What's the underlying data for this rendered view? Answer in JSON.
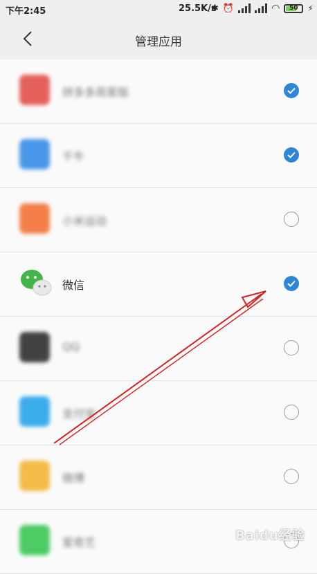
{
  "statusbar": {
    "time": "下午2:45",
    "speed": "25.5K/s",
    "battery": "50"
  },
  "header": {
    "title": "管理应用"
  },
  "apps": [
    {
      "name": "拼多多商家版",
      "checked": true,
      "icon_color": "#e0473f",
      "blurred": true
    },
    {
      "name": "千牛",
      "checked": true,
      "icon_color": "#2b86e6",
      "blurred": true
    },
    {
      "name": "小米运动",
      "checked": false,
      "icon_color": "#f36a2a",
      "blurred": true
    },
    {
      "name": "微信",
      "checked": true,
      "icon_color": "#44b549",
      "blurred": false
    },
    {
      "name": "QQ",
      "checked": false,
      "icon_color": "#222222",
      "blurred": true
    },
    {
      "name": "支付宝",
      "checked": false,
      "icon_color": "#1aa0e8",
      "blurred": true
    },
    {
      "name": "微博",
      "checked": false,
      "icon_color": "#f2b129",
      "blurred": true
    },
    {
      "name": "爱奇艺",
      "checked": false,
      "icon_color": "#2fc34a",
      "blurred": true
    }
  ],
  "watermark": "Baidu经验",
  "colors": {
    "check_on": "#2f86d6",
    "annotation_arrow": "#d61f1f"
  }
}
